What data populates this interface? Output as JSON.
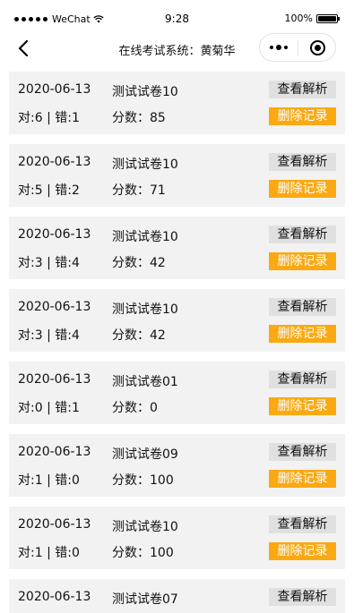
{
  "status_bar": {
    "carrier": "WeChat",
    "time": "9:28",
    "battery": "100%",
    "battery_level": 1.0
  },
  "nav": {
    "title": "在线考试系统：黄菊华"
  },
  "records": [
    {
      "date": "2020-06-13",
      "paper": "测试试卷10",
      "score": "对:6 | 错:1",
      "points": "分数：85",
      "view_label": "查看解析",
      "delete_label": "删除记录"
    },
    {
      "date": "2020-06-13",
      "paper": "测试试卷10",
      "score": "对:5 | 错:2",
      "points": "分数：71",
      "view_label": "查看解析",
      "delete_label": "删除记录"
    },
    {
      "date": "2020-06-13",
      "paper": "测试试卷10",
      "score": "对:3 | 错:4",
      "points": "分数：42",
      "view_label": "查看解析",
      "delete_label": "删除记录"
    },
    {
      "date": "2020-06-13",
      "paper": "测试试卷10",
      "score": "对:3 | 错:4",
      "points": "分数：42",
      "view_label": "查看解析",
      "delete_label": "删除记录"
    },
    {
      "date": "2020-06-13",
      "paper": "测试试卷01",
      "score": "对:0 | 错:1",
      "points": "分数：0",
      "view_label": "查看解析",
      "delete_label": "删除记录"
    },
    {
      "date": "2020-06-13",
      "paper": "测试试卷09",
      "score": "对:1 | 错:0",
      "points": "分数：100",
      "view_label": "查看解析",
      "delete_label": "删除记录"
    },
    {
      "date": "2020-06-13",
      "paper": "测试试卷10",
      "score": "对:1 | 错:0",
      "points": "分数：100",
      "view_label": "查看解析",
      "delete_label": "删除记录"
    },
    {
      "date": "2020-06-13",
      "paper": "测试试卷07",
      "score": "",
      "points": "",
      "view_label": "查看解析",
      "delete_label": ""
    }
  ],
  "icons": {
    "back": "chevron-left-icon",
    "more": "more-dots-icon",
    "close": "target-circle-icon",
    "wifi": "wifi-icon",
    "battery": "battery-icon"
  },
  "colors": {
    "delete_button": "#fba912",
    "view_button": "#e0e0e0",
    "record_background": "#f2f2f2"
  }
}
